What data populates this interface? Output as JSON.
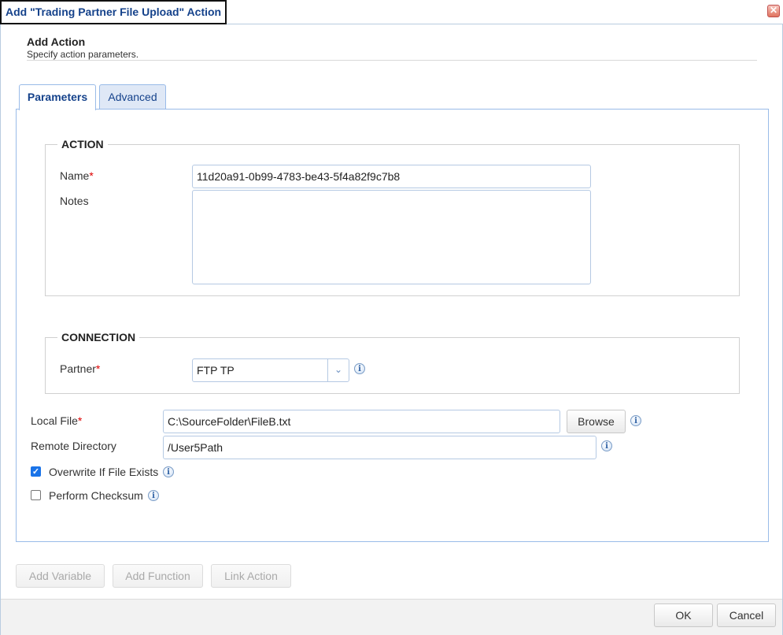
{
  "window": {
    "title": "Add \"Trading Partner File Upload\" Action",
    "close_glyph": "✕"
  },
  "header": {
    "title": "Add Action",
    "subtitle": "Specify action parameters."
  },
  "tabs": [
    {
      "label": "Parameters",
      "active": true
    },
    {
      "label": "Advanced",
      "active": false
    }
  ],
  "action_section": {
    "legend": "ACTION",
    "name_label": "Name",
    "name_value": "11d20a91-0b99-4783-be43-5f4a82f9c7b8",
    "notes_label": "Notes",
    "notes_value": ""
  },
  "connection_section": {
    "legend": "CONNECTION",
    "partner_label": "Partner",
    "partner_value": "FTP TP"
  },
  "fields": {
    "local_file_label": "Local File",
    "local_file_value": "C:\\SourceFolder\\FileB.txt",
    "browse_label": "Browse",
    "remote_dir_label": "Remote Directory",
    "remote_dir_value": "/User5Path",
    "overwrite_label": "Overwrite If File Exists",
    "overwrite_checked": true,
    "checksum_label": "Perform Checksum",
    "checksum_checked": false
  },
  "required_marker": "*",
  "info_glyph": "i",
  "toolbar": {
    "add_variable": "Add Variable",
    "add_function": "Add Function",
    "link_action": "Link Action"
  },
  "footer": {
    "ok": "OK",
    "cancel": "Cancel"
  },
  "colors": {
    "accent": "#15428b",
    "tab_border": "#99bbe8",
    "required": "#dd0000",
    "checkbox": "#1a73e8"
  }
}
